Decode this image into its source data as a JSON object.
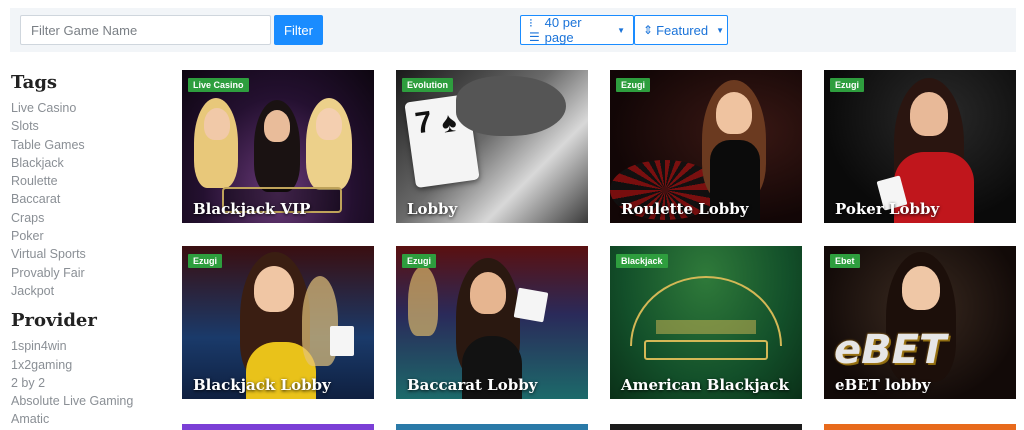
{
  "search": {
    "placeholder": "Filter Game Name"
  },
  "filter_button": "Filter",
  "per_page": {
    "label": "40 per page"
  },
  "sort": {
    "label": "Featured"
  },
  "sidebar": {
    "tags_heading": "Tags",
    "tags": [
      "Live Casino",
      "Slots",
      "Table Games",
      "Blackjack",
      "Roulette",
      "Baccarat",
      "Craps",
      "Poker",
      "Virtual Sports",
      "Provably Fair",
      "Jackpot"
    ],
    "provider_heading": "Provider",
    "providers": [
      "1spin4win",
      "1x2gaming",
      "2 by 2",
      "Absolute Live Gaming",
      "Amatic"
    ]
  },
  "games": [
    {
      "tag": "Live Casino",
      "title": "Blackjack VIP"
    },
    {
      "tag": "Evolution",
      "title": "Lobby"
    },
    {
      "tag": "Ezugi",
      "title": "Roulette Lobby"
    },
    {
      "tag": "Ezugi",
      "title": "Poker Lobby"
    },
    {
      "tag": "Ezugi",
      "title": "Blackjack Lobby"
    },
    {
      "tag": "Ezugi",
      "title": "Baccarat Lobby"
    },
    {
      "tag": "Blackjack",
      "title": "American Blackjack"
    },
    {
      "tag": "Ebet",
      "title": "eBET lobby"
    }
  ],
  "colors": {
    "accent": "#1a8cff",
    "tag_green": "#2e9e3e"
  }
}
